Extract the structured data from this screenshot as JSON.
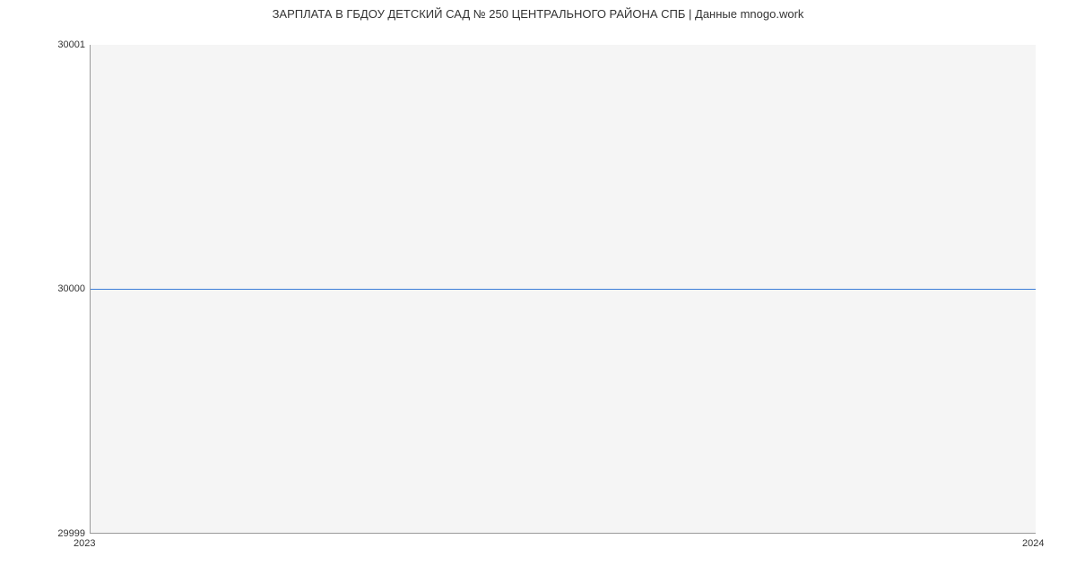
{
  "chart_data": {
    "type": "line",
    "title": "ЗАРПЛАТА В ГБДОУ ДЕТСКИЙ САД № 250 ЦЕНТРАЛЬНОГО РАЙОНА СПБ | Данные mnogo.work",
    "x": [
      2023,
      2024
    ],
    "values": [
      30000,
      30000
    ],
    "y_ticks": [
      29999,
      30000,
      30001
    ],
    "x_ticks": [
      2023,
      2024
    ],
    "ylim": [
      29999,
      30001
    ],
    "xlabel": "",
    "ylabel": ""
  }
}
